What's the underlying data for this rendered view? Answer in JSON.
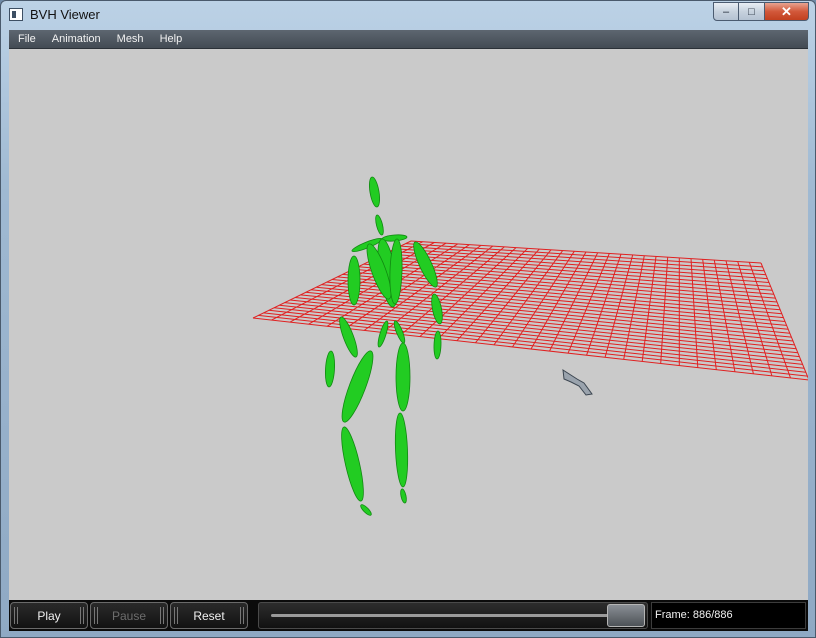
{
  "window": {
    "title": "BVH Viewer",
    "app_icon": "window-icon",
    "buttons": {
      "minimize": "–",
      "maximize": "□",
      "close": "✕"
    }
  },
  "menubar": {
    "items": [
      "File",
      "Animation",
      "Mesh",
      "Help"
    ]
  },
  "viewport": {
    "background_color": "#cacaca",
    "grid_color": "#e02020",
    "skeleton_color": "#22cc22",
    "cursor": "pointer-arrow-icon"
  },
  "controls": {
    "play_label": "Play",
    "pause_label": "Pause",
    "pause_disabled": true,
    "reset_label": "Reset",
    "frame_label": "Frame: 886/886",
    "progress": 1.0
  }
}
